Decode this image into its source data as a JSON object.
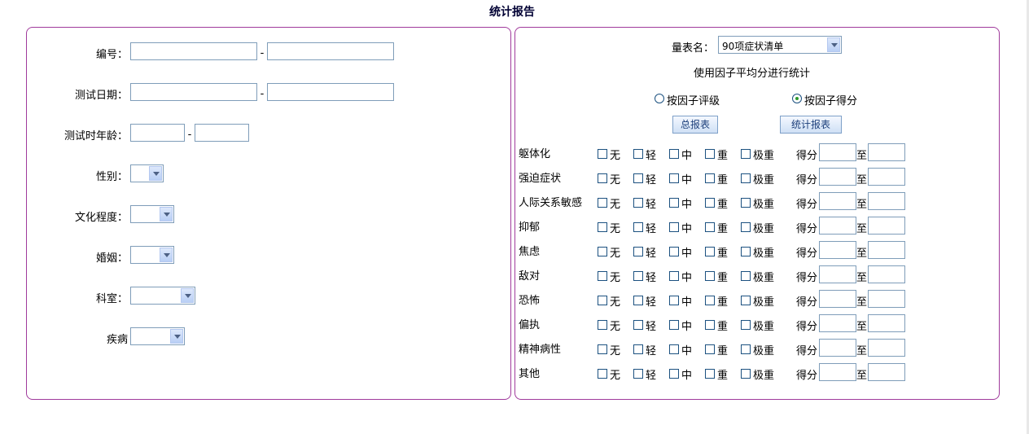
{
  "page": {
    "title": "统计报告"
  },
  "left": {
    "fields": [
      {
        "key": "number",
        "label": "编号：",
        "kind": "range-text"
      },
      {
        "key": "test_date",
        "label": "测试日期：",
        "kind": "range-text"
      },
      {
        "key": "age",
        "label": "测试时年龄：",
        "kind": "range-short"
      },
      {
        "key": "gender",
        "label": "性别：",
        "kind": "select",
        "value": ""
      },
      {
        "key": "education",
        "label": "文化程度：",
        "kind": "select",
        "value": ""
      },
      {
        "key": "marriage",
        "label": "婚姻：",
        "kind": "select",
        "value": ""
      },
      {
        "key": "department",
        "label": "科室：",
        "kind": "select",
        "value": ""
      },
      {
        "key": "disease",
        "label": "疾病",
        "kind": "select",
        "value": ""
      }
    ],
    "separator": "-"
  },
  "right": {
    "scale_label": "量表名：",
    "scale_value": "90项症状清单",
    "subtitle": "使用因子平均分进行统计",
    "radio_grade_label": "按因子评级",
    "radio_score_label": "按因子得分",
    "radio_selected": "score",
    "btn_total": "总报表",
    "btn_stats": "统计报表",
    "levels": [
      "无",
      "轻",
      "中",
      "重",
      "极重"
    ],
    "score_label": "得分",
    "to_label": "至",
    "factors": [
      "躯体化",
      "强迫症状",
      "人际关系敏感",
      "抑郁",
      "焦虑",
      "敌对",
      "恐怖",
      "偏执",
      "精神病性",
      "其他"
    ]
  }
}
